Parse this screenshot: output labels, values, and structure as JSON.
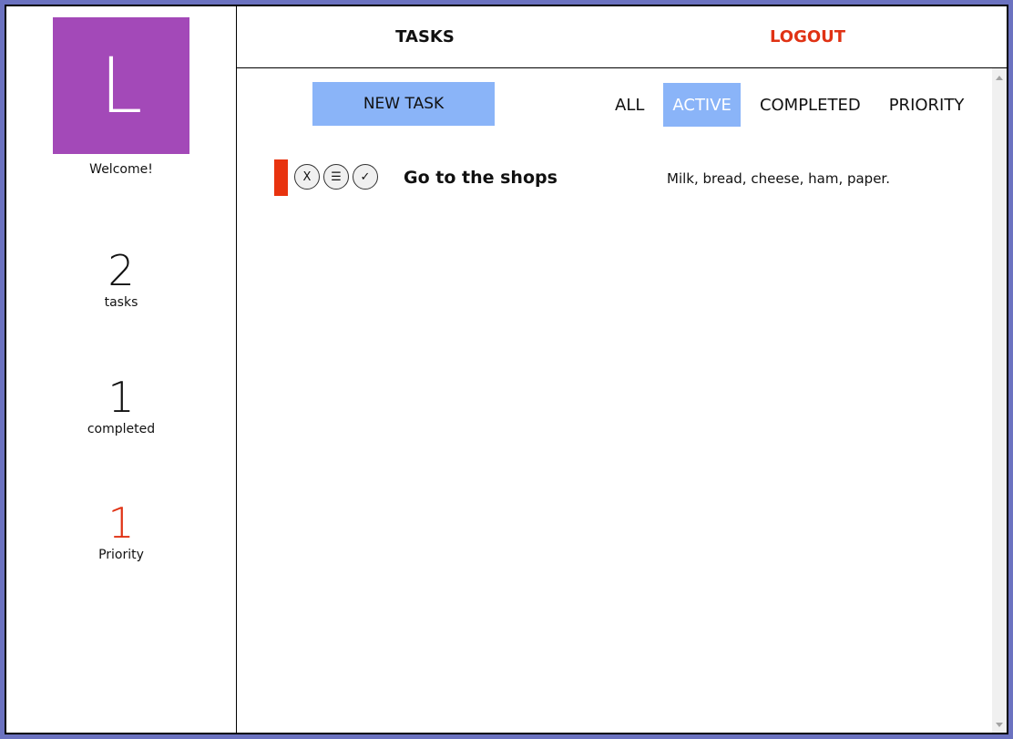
{
  "sidebar": {
    "avatar_letter": "L",
    "avatar_color": "#a349b8",
    "welcome": "Welcome!",
    "stats": [
      {
        "value": "2",
        "label": "tasks"
      },
      {
        "value": "1",
        "label": "completed"
      },
      {
        "value": "1",
        "label": "Priority",
        "color": "#e03214"
      }
    ]
  },
  "header": {
    "tasks_label": "TASKS",
    "logout_label": "LOGOUT"
  },
  "toolbar": {
    "new_task_label": "NEW TASK",
    "filters": [
      "ALL",
      "ACTIVE",
      "COMPLETED",
      "PRIORITY"
    ],
    "selected_filter": "ACTIVE"
  },
  "tasks": [
    {
      "title": "Go to the shops",
      "description": "Milk, bread, cheese, ham, paper.",
      "priority": true,
      "actions": [
        "X",
        "☰",
        "✓"
      ]
    }
  ],
  "colors": {
    "accent": "#8ab4f8",
    "priority": "#e03214"
  }
}
